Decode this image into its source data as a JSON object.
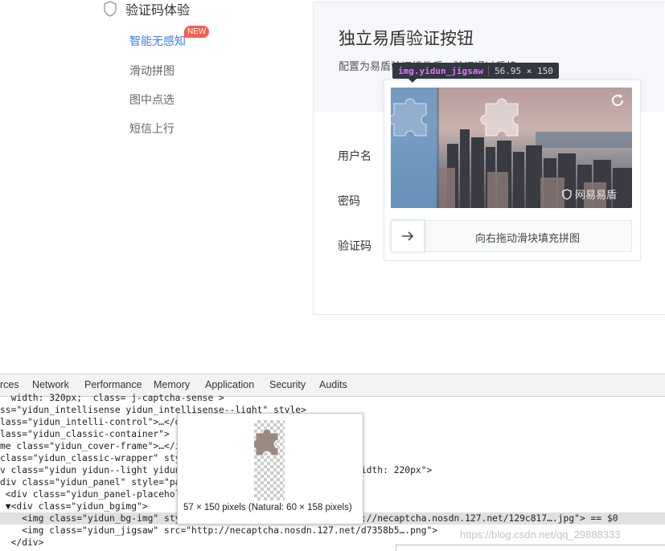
{
  "sidebar": {
    "heading": "验证码体验",
    "items": [
      {
        "label": "智能无感知",
        "badge": "NEW",
        "active": true
      },
      {
        "label": "滑动拼图"
      },
      {
        "label": "图中点选"
      },
      {
        "label": "短信上行"
      }
    ]
  },
  "panel": {
    "title": "独立易盾验证按钮",
    "description": "配置为易盾验证组件后，验证通过后将",
    "labels": {
      "username": "用户名",
      "password": "密码",
      "captcha": "验证码"
    }
  },
  "inspect_tooltip": {
    "selector": "img.yidun_jigsaw",
    "size": "56.95 × 150"
  },
  "captcha": {
    "slider_text": "向右拖动滑块填充拼图",
    "watermark": "网易易盾",
    "handle_icon": "arrow-right-icon",
    "refresh_icon": "refresh-icon"
  },
  "devtools": {
    "tabs": [
      "rces",
      "Network",
      "Performance",
      "Memory",
      "Application",
      "Security",
      "Audits"
    ],
    "lines": [
      {
        "t": "  width: 320px;  class= j-captcha-sense >"
      },
      {
        "t": "ss=\"yidun_intellisense yidun_intellisense--light\" style>"
      },
      {
        "t": "lass=\"yidun_intelli-control\">…</div>"
      },
      {
        "t": "lass=\"yidun_classic-container\">"
      },
      {
        "t": "me class=\"yidun_cover-frame\">…</iframe>"
      },
      {
        "t": "class=\"yidun_classic-wrapper\" style>"
      },
      {
        "t": "v class=\"yidun yidun--light yidun--                    auto; min-width: 220px\">"
      },
      {
        "t": "div class=\"yidun_panel\" style=\"padding"
      },
      {
        "t": " <div class=\"yidun_panel-placeholder"
      },
      {
        "t": " ▼<div class=\"yidun_bgimg\">"
      },
      {
        "t": "    <img class=\"yidun_bg-img\" style=\"border-radius: 2px\" src=\"http://necaptcha.nosdn.127.net/129c817….jpg\"> == $0"
      },
      {
        "t": "    <img class=\"yidun_jigsaw\" src=\"http://necaptcha.nosdn.127.net/d7358b5….png\">"
      },
      {
        "t": "  </div>"
      }
    ],
    "hover_caption": "57 × 150 pixels (Natural: 60 × 158 pixels)",
    "blog_watermark": "https://blog.csdn.net/qq_29888333"
  }
}
